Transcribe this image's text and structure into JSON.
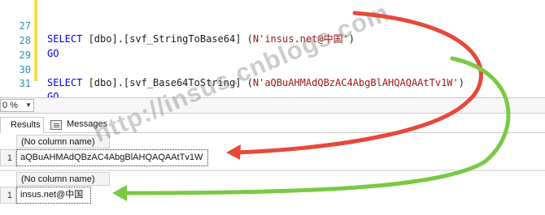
{
  "editor": {
    "lines": [
      {
        "number": "27",
        "prefix": "SELECT ",
        "object": "[dbo].[svf_StringToBase64]",
        "open": " (",
        "argument": "N'insus.net@中国'",
        "close": ")"
      },
      {
        "number": "28",
        "keyword": "GO"
      },
      {
        "number": "29"
      },
      {
        "number": "30",
        "prefix": "SELECT ",
        "object": "[dbo].[svf_Base64ToString]",
        "open": " (",
        "argument": "N'aQBuAHMAdQBzAC4AbgBlAHQAQAAtTv1W'",
        "close": ")"
      },
      {
        "number": "31",
        "keyword": "GO"
      }
    ]
  },
  "zoom": {
    "value": "0 %"
  },
  "tabs": {
    "results": "Results",
    "messages": "Messages"
  },
  "results": [
    {
      "header": "(No column name)",
      "row_number": "1",
      "value": "aQBuAHMAdQBzAC4AbgBlAHQAQAAtTv1W"
    },
    {
      "header": "(No column name)",
      "row_number": "1",
      "value": "insus.net@中国"
    }
  ],
  "watermark": "http://insus.cnblogs.com",
  "colors": {
    "red_arrow": "#e8483c",
    "green_arrow": "#7ac943",
    "keyword_blue": "#0000ff",
    "string_red": "#a31515"
  }
}
